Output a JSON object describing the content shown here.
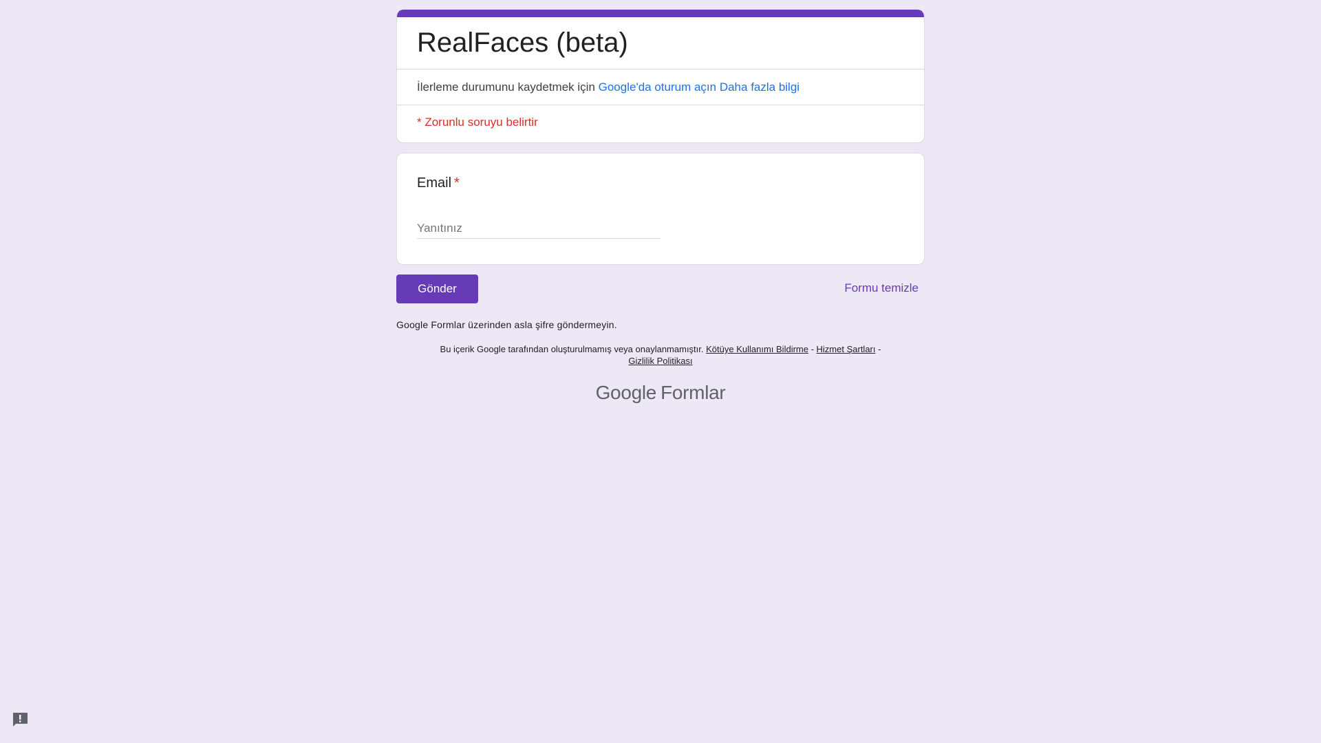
{
  "form": {
    "title": "RealFaces (beta)",
    "signin_prefix": "İlerleme durumunu kaydetmek için ",
    "signin_link": "Google'da oturum açın",
    "learn_more_link": "Daha fazla bilgi",
    "required_note": "* Zorunlu soruyu belirtir"
  },
  "question": {
    "label": "Email",
    "required_star": "*",
    "placeholder": "Yanıtınız",
    "value": ""
  },
  "actions": {
    "submit_label": "Gönder",
    "clear_label": "Formu temizle"
  },
  "footer": {
    "password_note": "Google Formlar üzerinden asla şifre göndermeyin.",
    "disclaimer_text": "Bu içerik Google tarafından oluşturulmamış veya onaylanmamıştır. ",
    "abuse_link": "Kötüye Kullanımı Bildirme",
    "separator": " - ",
    "terms_link": "Hizmet Şartları",
    "privacy_link": "Gizlilik Politikası",
    "brand_google": "Google",
    "brand_forms": "Formlar"
  },
  "colors": {
    "accent": "#673ab7",
    "background": "#ede7f6",
    "link": "#1a73e8",
    "required": "#d93025"
  },
  "icons": {
    "feedback": "report-feedback-icon"
  }
}
